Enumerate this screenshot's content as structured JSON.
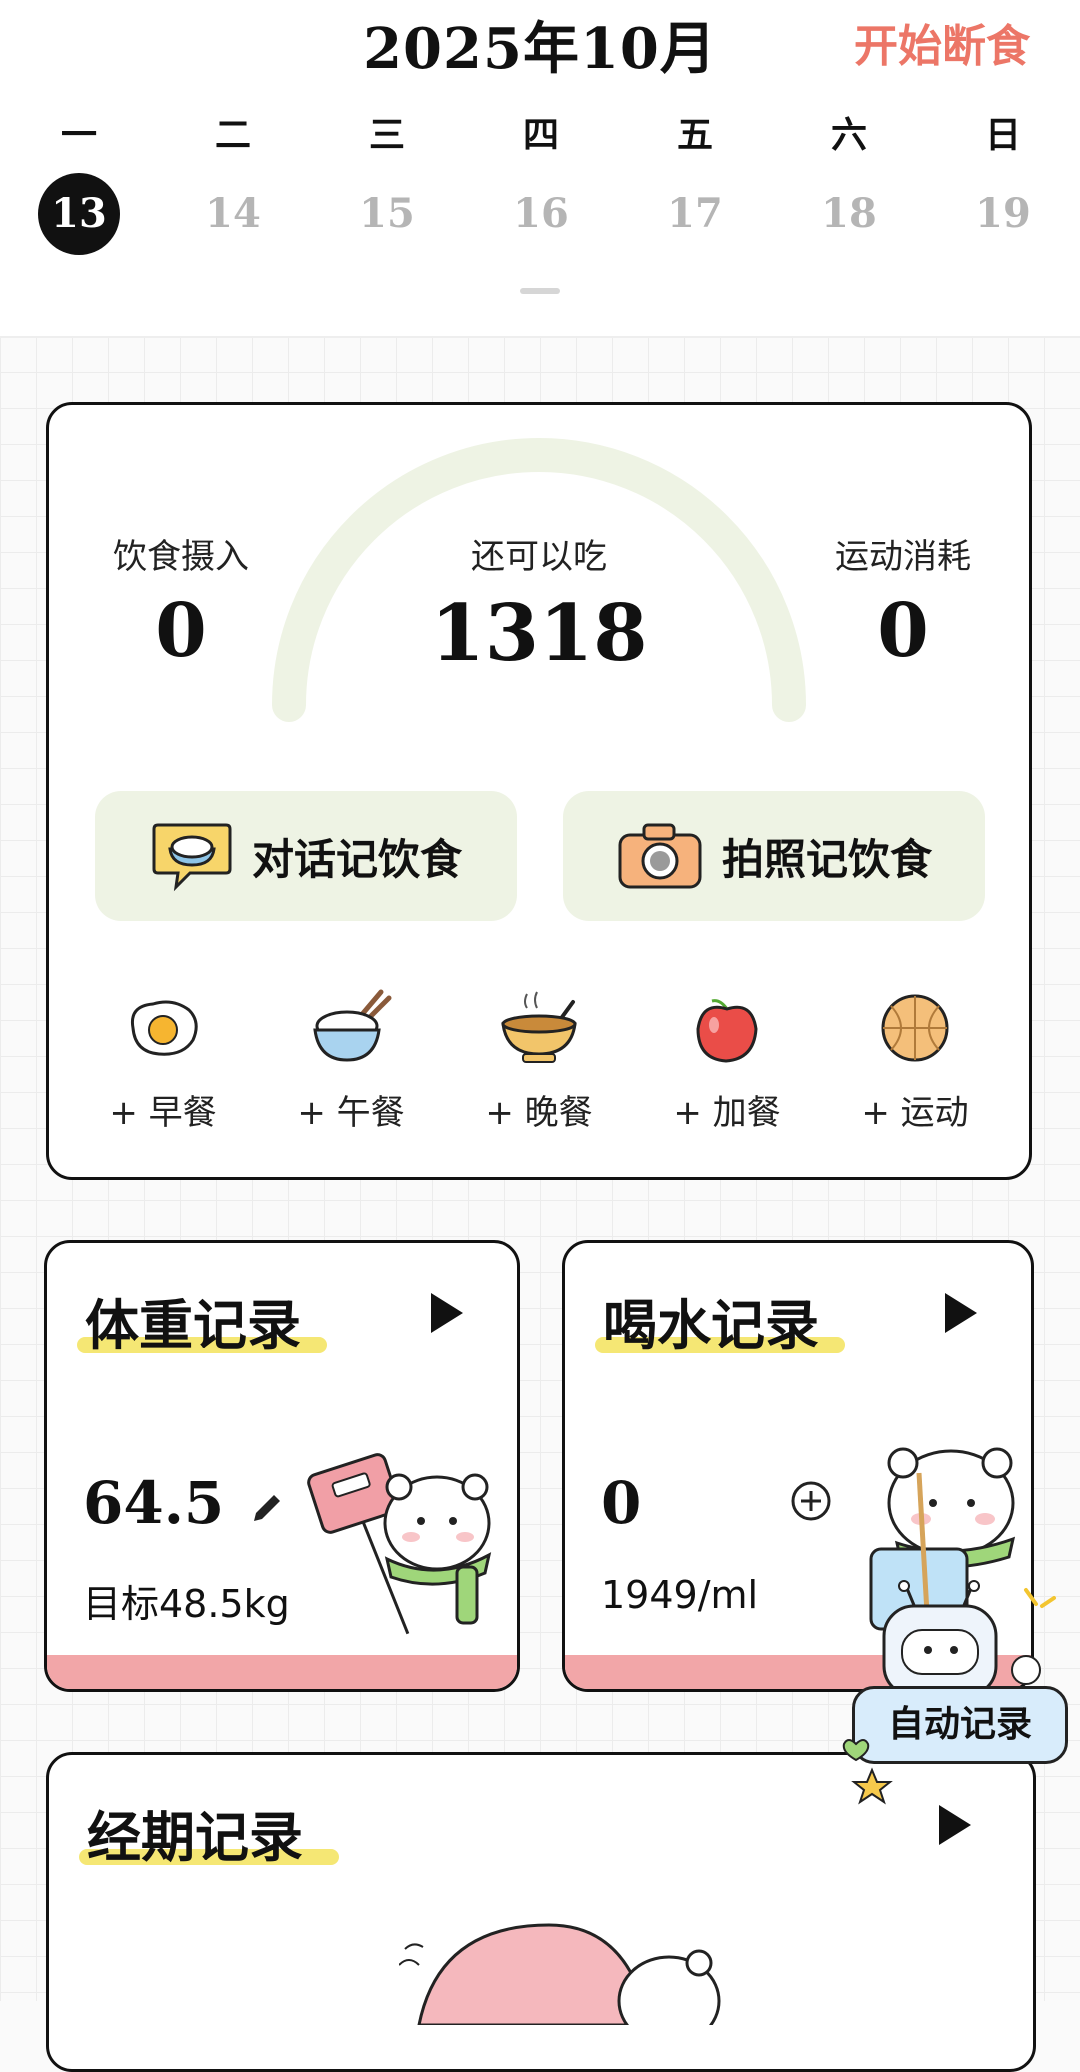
{
  "header": {
    "month_title": "2025年10月",
    "fast_label": "开始断食",
    "weekdays": [
      "一",
      "二",
      "三",
      "四",
      "五",
      "六",
      "日"
    ],
    "days": [
      "13",
      "14",
      "15",
      "16",
      "17",
      "18",
      "19"
    ],
    "selected_day": "13"
  },
  "summary": {
    "intake_label": "饮食摄入",
    "intake_value": "0",
    "remaining_label": "还可以吃",
    "remaining_value": "1318",
    "burn_label": "运动消耗",
    "burn_value": "0",
    "arc_color": "#eef3e4"
  },
  "log_buttons": {
    "chat_label": "对话记饮食",
    "photo_label": "拍照记饮食"
  },
  "meals": [
    {
      "label": "+ 早餐",
      "icon": "fried-egg-icon"
    },
    {
      "label": "+ 午餐",
      "icon": "rice-bowl-icon"
    },
    {
      "label": "+ 晚餐",
      "icon": "soup-bowl-icon"
    },
    {
      "label": "+ 加餐",
      "icon": "apple-icon"
    },
    {
      "label": "+ 运动",
      "icon": "basketball-icon"
    }
  ],
  "weight": {
    "title": "体重记录",
    "value": "64.5",
    "target": "目标48.5kg"
  },
  "water": {
    "title": "喝水记录",
    "value": "0",
    "goal": "1949/ml"
  },
  "period": {
    "title": "经期记录"
  },
  "auto_record_label": "自动记录",
  "colors": {
    "accent": "#ec7667",
    "pale_green": "#eef3e4",
    "highlight_yellow": "#f3e35c",
    "pink_strip": "#f2a6a8"
  }
}
